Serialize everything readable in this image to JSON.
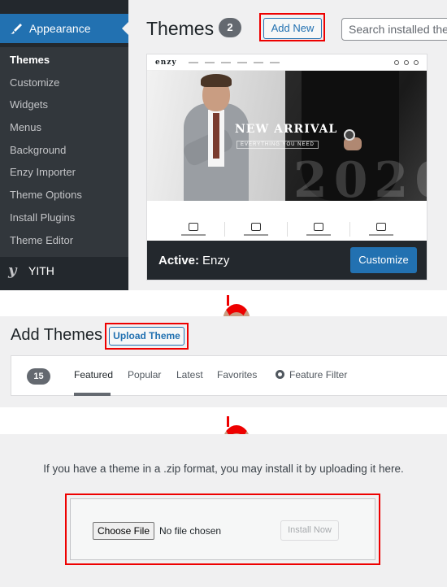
{
  "sidebar": {
    "menu_title": "Appearance",
    "items": [
      {
        "label": "Themes"
      },
      {
        "label": "Customize"
      },
      {
        "label": "Widgets"
      },
      {
        "label": "Menus"
      },
      {
        "label": "Background"
      },
      {
        "label": "Enzy Importer"
      },
      {
        "label": "Theme Options"
      },
      {
        "label": "Install Plugins"
      },
      {
        "label": "Theme Editor"
      }
    ],
    "next_menu": "YITH",
    "colors": {
      "bg": "#23282d",
      "active": "#2271b1"
    }
  },
  "themes_page": {
    "title": "Themes",
    "count": "2",
    "add_new": "Add New",
    "search_placeholder": "Search installed themes..."
  },
  "active_theme": {
    "preview": {
      "logo": "enzy",
      "hero_title": "NEW ARRIVAL",
      "hero_subtitle": "EVERYTHING YOU NEED",
      "hero_year": "2020"
    },
    "active_label": "Active:",
    "name": "Enzy",
    "customize": "Customize"
  },
  "add_themes": {
    "title": "Add Themes",
    "upload_button": "Upload Theme",
    "count": "15",
    "tabs": [
      "Featured",
      "Popular",
      "Latest",
      "Favorites",
      "Feature Filter"
    ]
  },
  "upload": {
    "message": "If you have a theme in a .zip format, you may install it by uploading it here.",
    "choose_file": "Choose File",
    "no_file": "No file chosen",
    "install_now": "Install Now"
  },
  "highlight_color": "#ee0000"
}
